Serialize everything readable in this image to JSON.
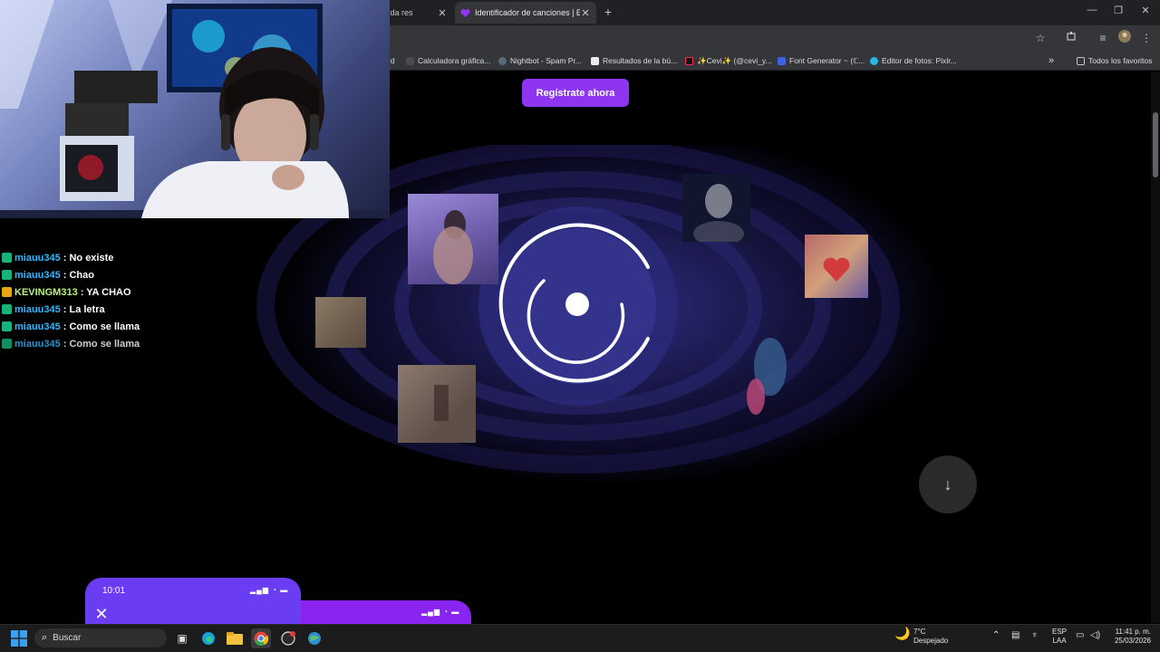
{
  "browser": {
    "tabs": [
      {
        "label": "to ayuda res",
        "active": false
      },
      {
        "label": "Identificador de canciones | En",
        "active": true
      }
    ],
    "new_tab": "+",
    "close_glyph": "✕",
    "window_controls": {
      "minimize": "—",
      "maximize": "❐",
      "close": "✕"
    },
    "bookmarks": [
      {
        "label": "rd",
        "icon": "bookmark-icon"
      },
      {
        "label": "Calculadora gráfica...",
        "icon": "desmos-icon"
      },
      {
        "label": "Nightbot - Spam Pr...",
        "icon": "nightbot-icon"
      },
      {
        "label": "Resultados de la bú...",
        "icon": "page-icon"
      },
      {
        "label": "✨Cevi✨ (@cevi_y...",
        "icon": "tiktok-icon"
      },
      {
        "label": "Font Generator ~ (ℂ...",
        "icon": "font-icon"
      },
      {
        "label": "Editor de fotos: Pixlr...",
        "icon": "pixlr-icon"
      }
    ],
    "bookmarks_overflow": "»",
    "all_favorites": "Todos los favoritos"
  },
  "page": {
    "cta_label": "Regístrate ahora",
    "scroll_down_glyph": "↓",
    "accent": "#8d35f0"
  },
  "chat": {
    "messages": [
      {
        "user": "miauu345",
        "text": ": No existe",
        "color": "#2fb7ff"
      },
      {
        "user": "miauu345",
        "text": ": Chao",
        "color": "#2fb7ff"
      },
      {
        "user": "KEVINGM313",
        "text": ": YA CHAO",
        "color": "#b6f47c"
      },
      {
        "user": "miauu345",
        "text": ": La letra",
        "color": "#2fb7ff"
      },
      {
        "user": "miauu345",
        "text": ": Como se llama",
        "color": "#2fb7ff"
      },
      {
        "user": "miauu345",
        "text": ": Como se llama",
        "color": "#2fb7ff"
      }
    ]
  },
  "phones": {
    "phone1_time": "10:01",
    "signal_glyphs": "▂▄▆ ◔ ▬"
  },
  "taskbar": {
    "search_label": "Buscar",
    "weather_temp": "7°C",
    "weather_desc": "Despejado",
    "language": "ESP",
    "language_sub": "LAA",
    "time": "11:41 p. m.",
    "date": "25/03/2026"
  }
}
